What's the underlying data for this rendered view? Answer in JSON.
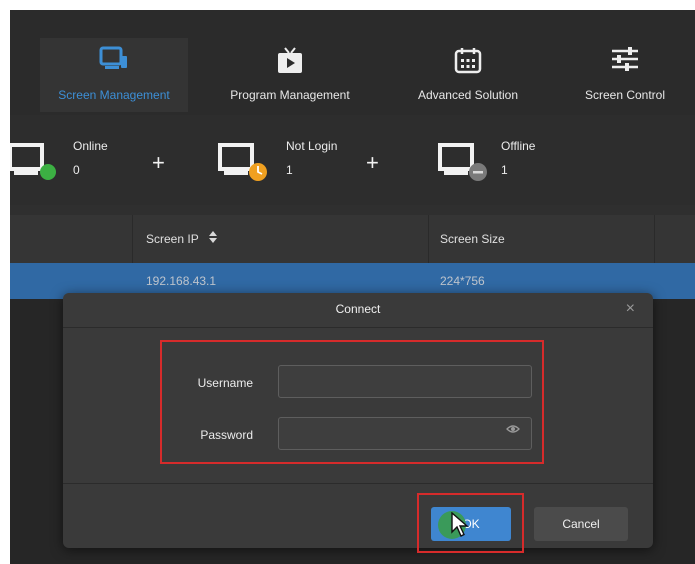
{
  "nav": {
    "items": [
      {
        "label": "Screen Management",
        "icon": "monitor-phone-icon",
        "active": true
      },
      {
        "label": "Program Management",
        "icon": "tv-play-icon"
      },
      {
        "label": "Advanced Solution",
        "icon": "calendar-icon"
      },
      {
        "label": "Screen Control",
        "icon": "sliders-icon"
      }
    ]
  },
  "status": {
    "online": {
      "title": "Online",
      "count": "0",
      "color": "#3cb043"
    },
    "not_login": {
      "title": "Not Login",
      "count": "1",
      "color": "#f0a020"
    },
    "offline": {
      "title": "Offline",
      "count": "1",
      "color": "#7a7a7a"
    },
    "plus": "+"
  },
  "table": {
    "columns": [
      "Screen IP",
      "Screen Size"
    ],
    "sort_icon": "sort-updown-icon",
    "rows": [
      {
        "ip": "192.168.43.1",
        "size": "224*756"
      }
    ]
  },
  "dialog": {
    "title": "Connect",
    "close": "×",
    "username_label": "Username",
    "username_value": "",
    "password_label": "Password",
    "password_value": "",
    "eye_icon": "eye-icon",
    "ok_label": "OK",
    "cancel_label": "Cancel"
  },
  "colors": {
    "accent": "#3d8fd6",
    "selection": "#3b80c9",
    "highlight": "#d62b2b"
  }
}
